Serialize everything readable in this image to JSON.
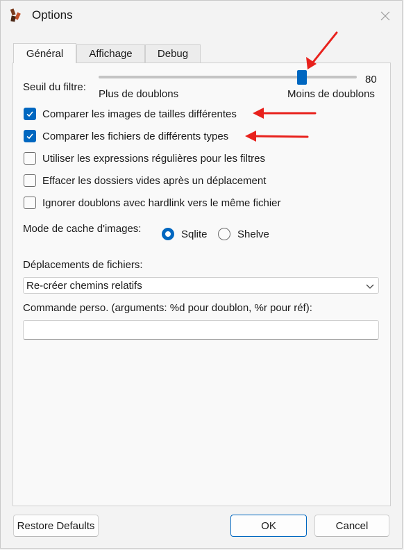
{
  "window": {
    "title": "Options",
    "icon": "app-icon"
  },
  "tabs": [
    {
      "label": "Général",
      "active": true
    },
    {
      "label": "Affichage",
      "active": false
    },
    {
      "label": "Debug",
      "active": false
    }
  ],
  "filter": {
    "label": "Seuil du filtre:",
    "value": "80",
    "value_fraction": 0.8,
    "min_label": "Plus de doublons",
    "max_label": "Moins de doublons"
  },
  "checkboxes": [
    {
      "label": "Comparer les images de tailles différentes",
      "checked": true
    },
    {
      "label": "Comparer les fichiers de différents types",
      "checked": true
    },
    {
      "label": "Utiliser les expressions régulières pour les filtres",
      "checked": false
    },
    {
      "label": "Effacer les dossiers vides après un déplacement",
      "checked": false
    },
    {
      "label": "Ignorer doublons avec hardlink vers le même fichier",
      "checked": false
    }
  ],
  "cache_mode": {
    "label": "Mode de cache d'images:",
    "options": [
      {
        "label": "Sqlite",
        "selected": true
      },
      {
        "label": "Shelve",
        "selected": false
      }
    ]
  },
  "move": {
    "label": "Déplacements de fichiers:",
    "selected": "Re-créer chemins relatifs"
  },
  "custom_command": {
    "label": "Commande perso. (arguments: %d pour doublon, %r pour réf):",
    "value": ""
  },
  "buttons": {
    "restore": "Restore Defaults",
    "ok": "OK",
    "cancel": "Cancel"
  },
  "colors": {
    "accent": "#0067c0",
    "annotation_arrow": "#e8211c"
  }
}
